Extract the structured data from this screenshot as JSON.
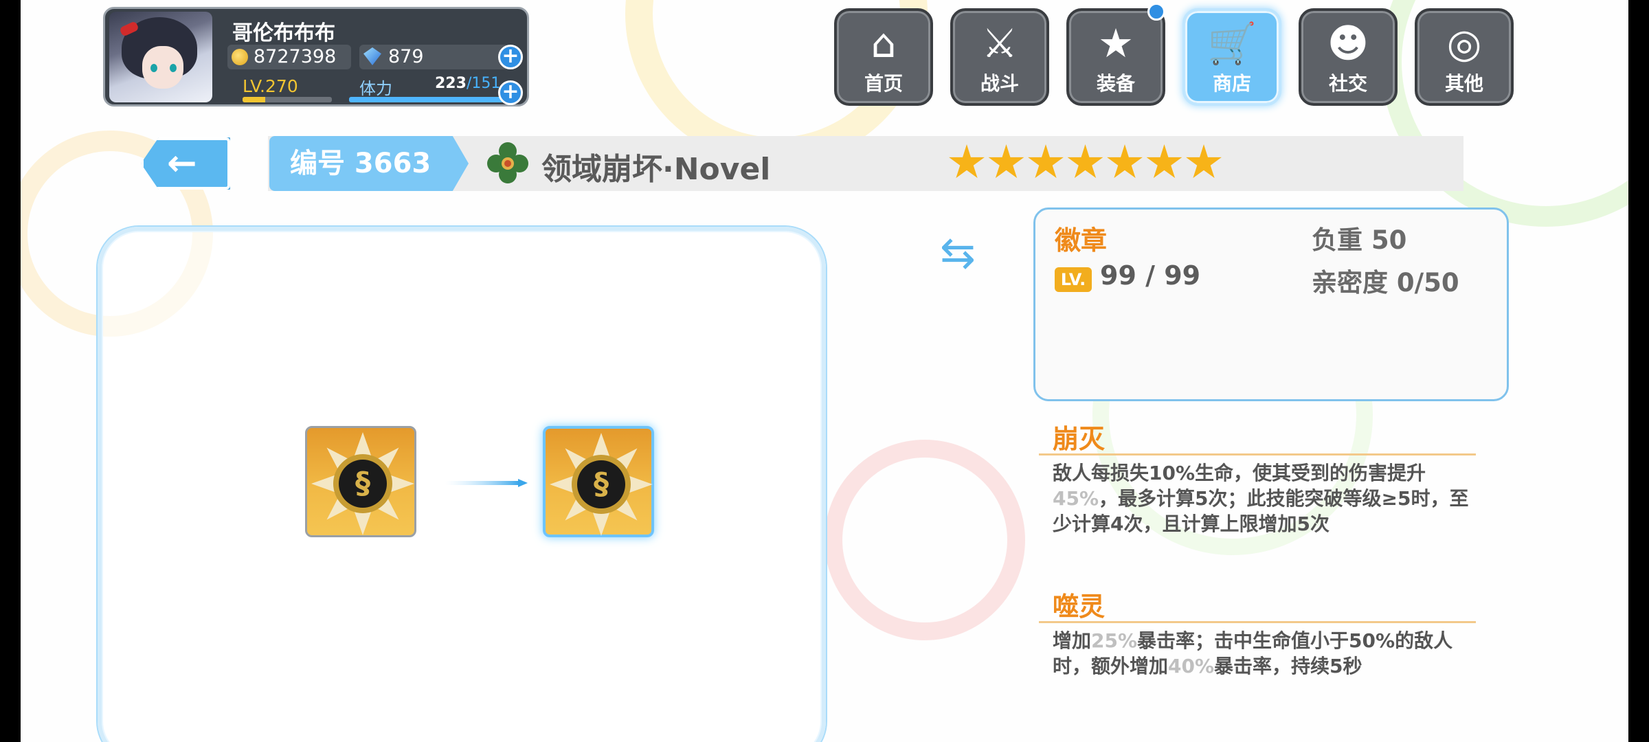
{
  "player": {
    "name": "哥伦布布布",
    "gold": "8727398",
    "crystals": "879",
    "level": "LV.270",
    "level_progress": 0.25,
    "stamina_label": "体力",
    "stamina_current": "223",
    "stamina_max": "/151",
    "stamina_progress": 1.0
  },
  "nav": [
    {
      "label": "首页",
      "icon": "home-icon"
    },
    {
      "label": "战斗",
      "icon": "battle-icon"
    },
    {
      "label": "装备",
      "icon": "equipment-icon"
    },
    {
      "label": "商店",
      "icon": "shop-icon"
    },
    {
      "label": "社交",
      "icon": "social-icon"
    },
    {
      "label": "其他",
      "icon": "other-icon"
    }
  ],
  "header": {
    "id_label": "编号 3663",
    "item_name": "领域崩坏·Novel",
    "stars": 7
  },
  "info": {
    "type": "徽章",
    "weight": "负重 50",
    "lv_badge": "LV.",
    "level": "99 / 99",
    "affinity": "亲密度 0/50"
  },
  "skills": [
    {
      "name": "崩灭",
      "desc_parts": [
        "敌人每损失10%生命，使其受到的伤害提升",
        "45%",
        "，最多计算5次；此技能突破等级≥5时，至少计算4次，且计算上限增加5次"
      ]
    },
    {
      "name": "噬灵",
      "desc_parts": [
        "增加",
        "25%",
        "暴击率；击中生命值小于50%的敌人时，额外增加",
        "40%",
        "暴击率，持续5秒"
      ]
    }
  ],
  "colors": {
    "accent_blue": "#5bb8f0",
    "skill_orange": "#ef8a1b",
    "star_gold": "#f7b318"
  }
}
